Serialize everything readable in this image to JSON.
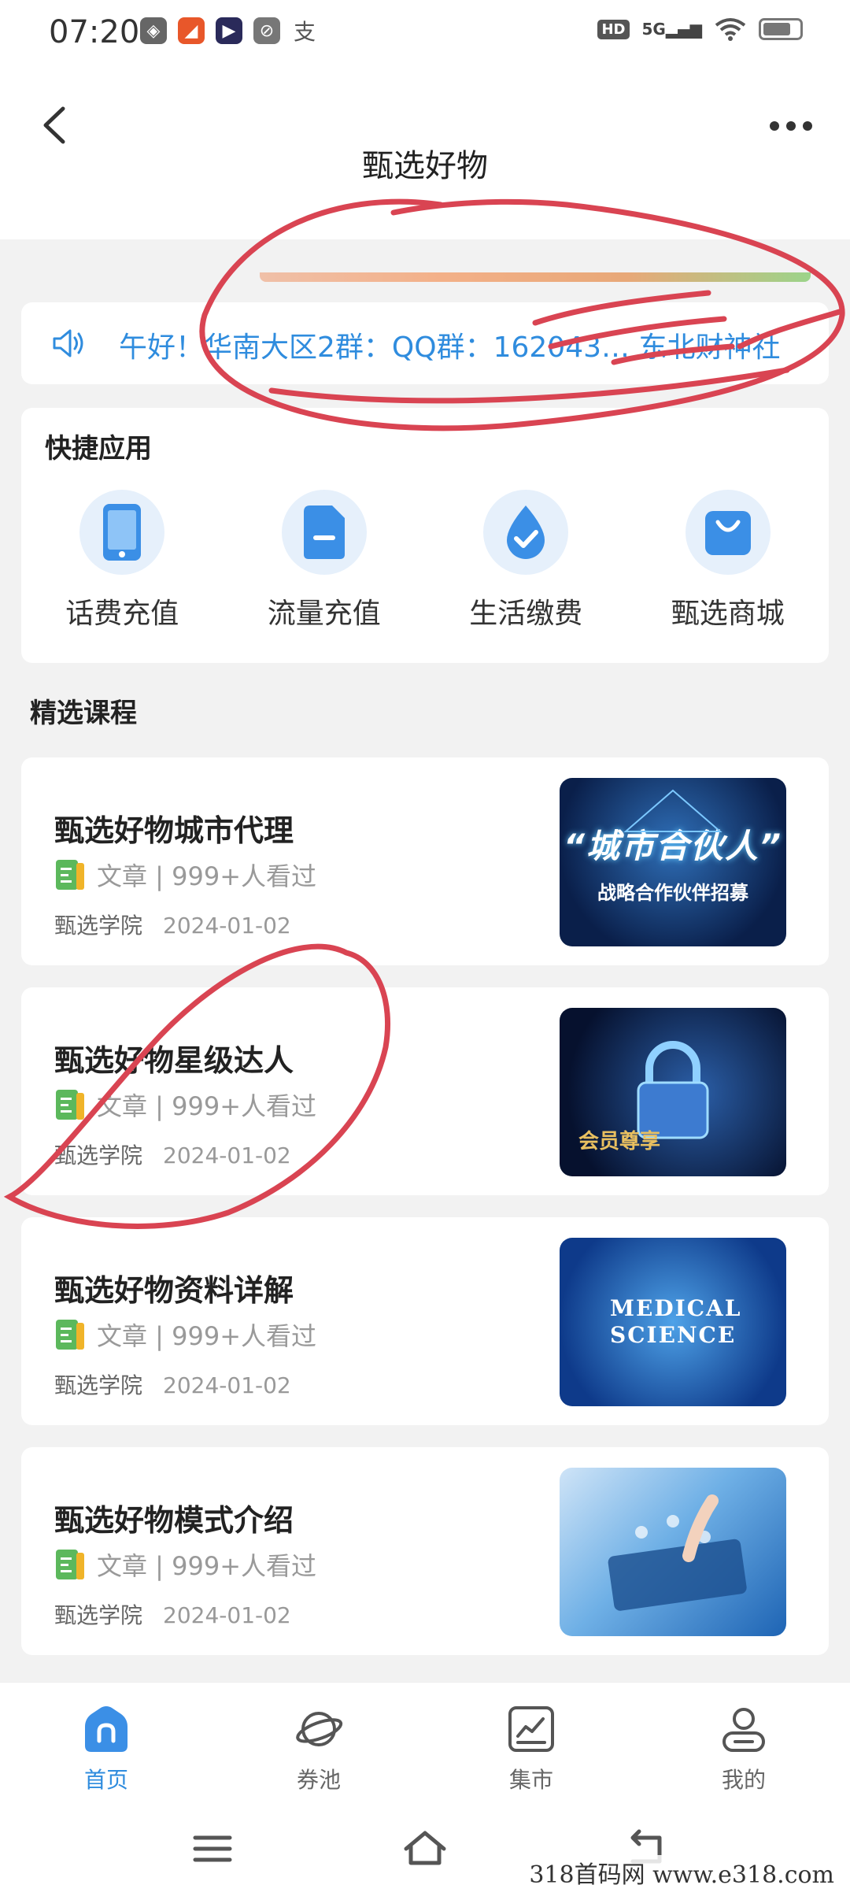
{
  "status_bar": {
    "time": "07:20",
    "network": "5G",
    "hd": "HD"
  },
  "header": {
    "title": "甄选好物"
  },
  "notice": {
    "text": "午好！华南大区2群：QQ群：162043… 东北财神社"
  },
  "quick_apps": {
    "title": "快捷应用",
    "items": [
      {
        "label": "话费充值",
        "icon": "phone-icon"
      },
      {
        "label": "流量充值",
        "icon": "sim-card-icon"
      },
      {
        "label": "生活缴费",
        "icon": "water-drop-icon"
      },
      {
        "label": "甄选商城",
        "icon": "shopping-bag-icon"
      }
    ]
  },
  "courses": {
    "title": "精选课程",
    "items": [
      {
        "title": "甄选好物城市代理",
        "meta": "文章 | 999+人看过",
        "source": "甄选学院",
        "date": "2024-01-02",
        "thumb_main": "“城市合伙人”",
        "thumb_sub": "战略合作伙伴招募"
      },
      {
        "title": "甄选好物星级达人",
        "meta": "文章 | 999+人看过",
        "source": "甄选学院",
        "date": "2024-01-02",
        "thumb_sub": "会员尊享"
      },
      {
        "title": "甄选好物资料详解",
        "meta": "文章 | 999+人看过",
        "source": "甄选学院",
        "date": "2024-01-02",
        "thumb_main": "MEDICAL SCIENCE"
      },
      {
        "title": "甄选好物模式介绍",
        "meta": "文章 | 999+人看过",
        "source": "甄选学院",
        "date": "2024-01-02"
      }
    ]
  },
  "tabbar": {
    "items": [
      {
        "label": "首页",
        "icon": "home-icon",
        "active": true
      },
      {
        "label": "券池",
        "icon": "planet-icon",
        "active": false
      },
      {
        "label": "集市",
        "icon": "chart-icon",
        "active": false
      },
      {
        "label": "我的",
        "icon": "user-icon",
        "active": false
      }
    ]
  },
  "watermark": "318首码网 www.e318.com",
  "colors": {
    "accent": "#2f8cde",
    "annotation": "#d94452",
    "background": "#f2f2f2"
  }
}
